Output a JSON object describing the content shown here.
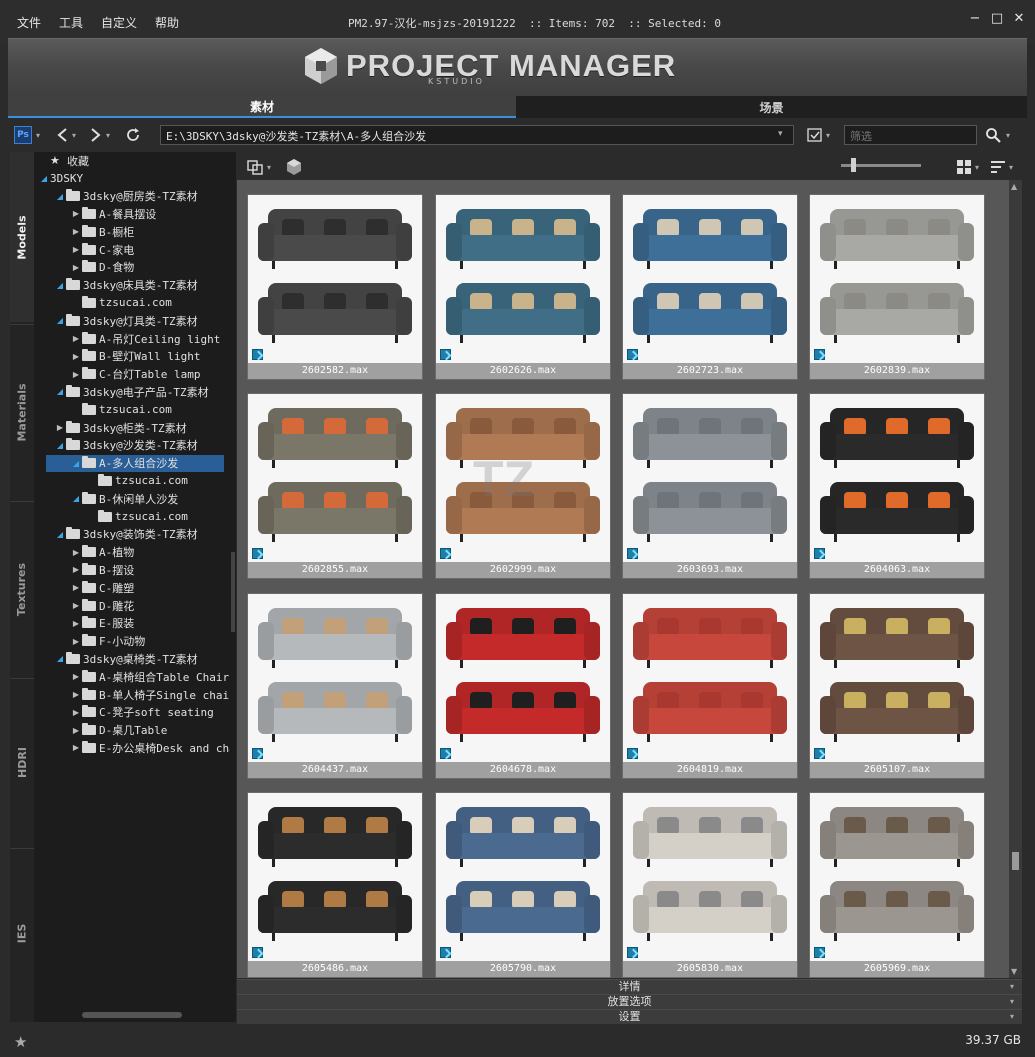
{
  "menu": [
    "文件",
    "工具",
    "自定义",
    "帮助"
  ],
  "window_title": "PM2.97-汉化-msjzs-20191222  :: Items: 702  :: Selected: 0",
  "window_controls": {
    "minimize": "−",
    "maximize": "□",
    "close": "✕"
  },
  "banner": {
    "logo_text": "PROJECT MANAGER",
    "logo_sub": "KSTUDIO"
  },
  "tabs": [
    "素材",
    "场景"
  ],
  "toolbar": {
    "ps_label": "Ps",
    "path": "E:\\3DSKY\\3dsky@沙发类-TZ素材\\A-多人组合沙发",
    "filter_placeholder": "筛选"
  },
  "side_tabs": [
    "Models",
    "Materials",
    "Textures",
    "HDRI",
    "IES"
  ],
  "tree": [
    {
      "label": "收藏",
      "indent": 0,
      "arrow": "",
      "icon": "star"
    },
    {
      "label": "3DSKY",
      "indent": 0,
      "arrow": "open",
      "icon": "none"
    },
    {
      "label": "3dsky@厨房类-TZ素材",
      "indent": 1,
      "arrow": "open",
      "icon": "folder"
    },
    {
      "label": "A-餐具摆设",
      "indent": 2,
      "arrow": "closed",
      "icon": "folder"
    },
    {
      "label": "B-橱柜",
      "indent": 2,
      "arrow": "closed",
      "icon": "folder"
    },
    {
      "label": "C-家电",
      "indent": 2,
      "arrow": "closed",
      "icon": "folder"
    },
    {
      "label": "D-食物",
      "indent": 2,
      "arrow": "closed",
      "icon": "folder"
    },
    {
      "label": "3dsky@床具类-TZ素材",
      "indent": 1,
      "arrow": "open",
      "icon": "folder"
    },
    {
      "label": "tzsucai.com",
      "indent": 2,
      "arrow": "",
      "icon": "folder"
    },
    {
      "label": "3dsky@灯具类-TZ素材",
      "indent": 1,
      "arrow": "open",
      "icon": "folder"
    },
    {
      "label": "A-吊灯Ceiling light",
      "indent": 2,
      "arrow": "closed",
      "icon": "folder"
    },
    {
      "label": "B-壁灯Wall light",
      "indent": 2,
      "arrow": "closed",
      "icon": "folder"
    },
    {
      "label": "C-台灯Table lamp",
      "indent": 2,
      "arrow": "closed",
      "icon": "folder"
    },
    {
      "label": "3dsky@电子产品-TZ素材",
      "indent": 1,
      "arrow": "open",
      "icon": "folder"
    },
    {
      "label": "tzsucai.com",
      "indent": 2,
      "arrow": "",
      "icon": "folder"
    },
    {
      "label": "3dsky@柜类-TZ素材",
      "indent": 1,
      "arrow": "closed",
      "icon": "folder"
    },
    {
      "label": "3dsky@沙发类-TZ素材",
      "indent": 1,
      "arrow": "open",
      "icon": "folder"
    },
    {
      "label": "A-多人组合沙发",
      "indent": 2,
      "arrow": "open",
      "icon": "folder",
      "selected": true
    },
    {
      "label": "tzsucai.com",
      "indent": 3,
      "arrow": "",
      "icon": "folder"
    },
    {
      "label": "B-休闲单人沙发",
      "indent": 2,
      "arrow": "open",
      "icon": "folder"
    },
    {
      "label": "tzsucai.com",
      "indent": 3,
      "arrow": "",
      "icon": "folder"
    },
    {
      "label": "3dsky@装饰类-TZ素材",
      "indent": 1,
      "arrow": "open",
      "icon": "folder"
    },
    {
      "label": "A-植物",
      "indent": 2,
      "arrow": "closed",
      "icon": "folder"
    },
    {
      "label": "B-摆设",
      "indent": 2,
      "arrow": "closed",
      "icon": "folder"
    },
    {
      "label": "C-雕塑",
      "indent": 2,
      "arrow": "closed",
      "icon": "folder"
    },
    {
      "label": "D-雕花",
      "indent": 2,
      "arrow": "closed",
      "icon": "folder"
    },
    {
      "label": "E-服装",
      "indent": 2,
      "arrow": "closed",
      "icon": "folder"
    },
    {
      "label": "F-小动物",
      "indent": 2,
      "arrow": "closed",
      "icon": "folder"
    },
    {
      "label": "3dsky@桌椅类-TZ素材",
      "indent": 1,
      "arrow": "open",
      "icon": "folder"
    },
    {
      "label": "A-桌椅组合Table Chair",
      "indent": 2,
      "arrow": "closed",
      "icon": "folder"
    },
    {
      "label": "B-单人椅子Single chair",
      "indent": 2,
      "arrow": "closed",
      "icon": "folder"
    },
    {
      "label": "C-凳子soft seating",
      "indent": 2,
      "arrow": "closed",
      "icon": "folder"
    },
    {
      "label": "D-桌几Table",
      "indent": 2,
      "arrow": "closed",
      "icon": "folder"
    },
    {
      "label": "E-办公桌椅Desk and chair",
      "indent": 2,
      "arrow": "closed",
      "icon": "folder"
    }
  ],
  "items": [
    {
      "name": "2602582.max",
      "color": "#4a4a4a",
      "pillow": "#2e2e2e",
      "bg": "#f6f6f6"
    },
    {
      "name": "2602626.max",
      "color": "#3f6e86",
      "pillow": "#c9b38a",
      "bg": "#f6f6f6"
    },
    {
      "name": "2602723.max",
      "color": "#3e6f98",
      "pillow": "#cfc7b4",
      "bg": "#f6f6f6"
    },
    {
      "name": "2602839.max",
      "color": "#a8a8a4",
      "pillow": "#8c8a84",
      "bg": "#f6f6f6"
    },
    {
      "name": "2602855.max",
      "color": "#7a7668",
      "pillow": "#d46a3a",
      "bg": "#f6f6f6"
    },
    {
      "name": "2602999.max",
      "color": "#b07a54",
      "pillow": "#8a5a3c",
      "bg": "#f6f6f6"
    },
    {
      "name": "2603693.max",
      "color": "#8c9298",
      "pillow": "#6e7479",
      "bg": "#f6f6f6"
    },
    {
      "name": "2604063.max",
      "color": "#2a2a2a",
      "pillow": "#e06a2a",
      "bg": "#f6f6f6"
    },
    {
      "name": "2604437.max",
      "color": "#b5b9bc",
      "pillow": "#c2a07a",
      "bg": "#f6f6f6"
    },
    {
      "name": "2604678.max",
      "color": "#c42a2a",
      "pillow": "#1f1f1f",
      "bg": "#f6f6f6"
    },
    {
      "name": "2604819.max",
      "color": "#c8473c",
      "pillow": "#a83830",
      "bg": "#f6f6f6"
    },
    {
      "name": "2605107.max",
      "color": "#6e5444",
      "pillow": "#c8b060",
      "bg": "#f6f6f6"
    },
    {
      "name": "2605486.max",
      "color": "#2c2c2c",
      "pillow": "#b07a44",
      "bg": "#f6f6f6"
    },
    {
      "name": "2605790.max",
      "color": "#4a6a90",
      "pillow": "#d8cdb8",
      "bg": "#f6f6f6"
    },
    {
      "name": "2605830.max",
      "color": "#d4d0c8",
      "pillow": "#8a8a8a",
      "bg": "#f6f6f6"
    },
    {
      "name": "2605969.max",
      "color": "#9c9690",
      "pillow": "#6a5a4a",
      "bg": "#f6f6f6"
    }
  ],
  "panels": [
    "详情",
    "放置选项",
    "设置"
  ],
  "status": {
    "disk_free": "39.37 GB"
  }
}
